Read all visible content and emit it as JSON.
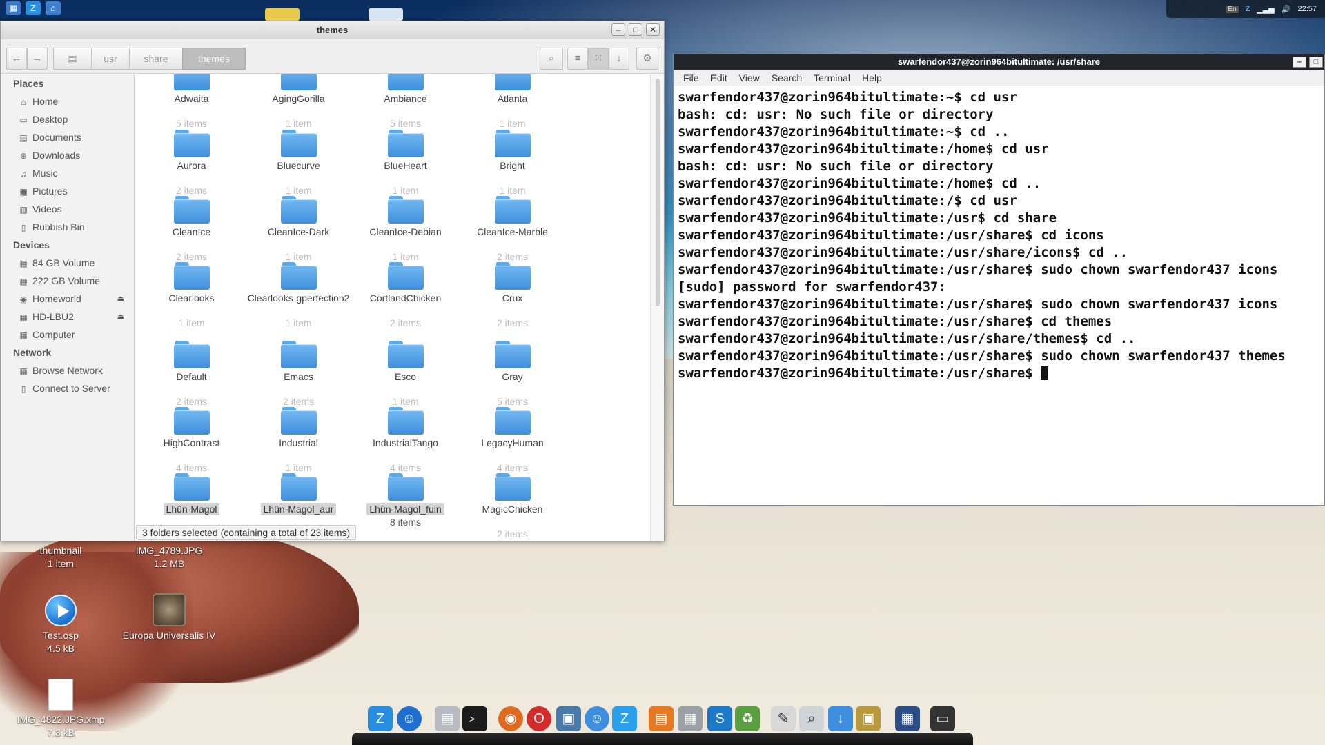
{
  "top_panel": {
    "tray": {
      "lang": "En",
      "clock": "22:57",
      "volume_icon": "speaker-icon"
    }
  },
  "file_manager": {
    "title": "themes",
    "breadcrumbs": [
      "usr",
      "share",
      "themes"
    ],
    "sidebar": {
      "sections": [
        {
          "heading": "Places",
          "items": [
            "Home",
            "Desktop",
            "Documents",
            "Downloads",
            "Music",
            "Pictures",
            "Videos",
            "Rubbish Bin"
          ]
        },
        {
          "heading": "Devices",
          "items": [
            "84 GB Volume",
            "222 GB Volume",
            "Homeworld",
            "HD-LBU2",
            "Computer"
          ]
        },
        {
          "heading": "Network",
          "items": [
            "Browse Network",
            "Connect to Server"
          ]
        }
      ]
    },
    "folders": [
      {
        "name": "Adwaita",
        "count": "5 items"
      },
      {
        "name": "AgingGorilla",
        "count": "1 item"
      },
      {
        "name": "Ambiance",
        "count": "5 items"
      },
      {
        "name": "Atlanta",
        "count": "1 item"
      },
      {
        "name": "Aurora",
        "count": "2 items"
      },
      {
        "name": "Bluecurve",
        "count": "1 item"
      },
      {
        "name": "BlueHeart",
        "count": "1 item"
      },
      {
        "name": "Bright",
        "count": "1 item"
      },
      {
        "name": "CleanIce",
        "count": "2 items"
      },
      {
        "name": "CleanIce-Dark",
        "count": "1 item"
      },
      {
        "name": "CleanIce-Debian",
        "count": "1 item"
      },
      {
        "name": "CleanIce-Marble",
        "count": "2 items"
      },
      {
        "name": "Clearlooks",
        "count": "1 item"
      },
      {
        "name": "Clearlooks-gperfection2",
        "count": "1 item"
      },
      {
        "name": "CortlandChicken",
        "count": "2 items"
      },
      {
        "name": "Crux",
        "count": "2 items"
      },
      {
        "name": "Default",
        "count": "2 items"
      },
      {
        "name": "Emacs",
        "count": "2 items"
      },
      {
        "name": "Esco",
        "count": "1 item"
      },
      {
        "name": "Gray",
        "count": "5 items"
      },
      {
        "name": "HighContrast",
        "count": "4 items"
      },
      {
        "name": "Industrial",
        "count": "1 item"
      },
      {
        "name": "IndustrialTango",
        "count": "4 items"
      },
      {
        "name": "LegacyHuman",
        "count": "4 items"
      },
      {
        "name": "Lhûn-Magol",
        "count": ""
      },
      {
        "name": "Lhûn-Magol_aur",
        "count": ""
      },
      {
        "name": "Lhûn-Magol_fuin",
        "count": "8 items"
      },
      {
        "name": "MagicChicken",
        "count": "2 items"
      }
    ],
    "status": "3 folders selected (containing a total of 23 items)"
  },
  "terminal": {
    "title": "swarfendor437@zorin964bitultimate: /usr/share",
    "menu": [
      "File",
      "Edit",
      "View",
      "Search",
      "Terminal",
      "Help"
    ],
    "lines": [
      "swarfendor437@zorin964bitultimate:~$ cd usr",
      "bash: cd: usr: No such file or directory",
      "swarfendor437@zorin964bitultimate:~$ cd ..",
      "swarfendor437@zorin964bitultimate:/home$ cd usr",
      "bash: cd: usr: No such file or directory",
      "swarfendor437@zorin964bitultimate:/home$ cd ..",
      "swarfendor437@zorin964bitultimate:/$ cd usr",
      "swarfendor437@zorin964bitultimate:/usr$ cd share",
      "swarfendor437@zorin964bitultimate:/usr/share$ cd icons",
      "swarfendor437@zorin964bitultimate:/usr/share/icons$ cd ..",
      "swarfendor437@zorin964bitultimate:/usr/share$ sudo chown swarfendor437 icons",
      "[sudo] password for swarfendor437:",
      "swarfendor437@zorin964bitultimate:/usr/share$ sudo chown swarfendor437 icons",
      "swarfendor437@zorin964bitultimate:/usr/share$ cd themes",
      "swarfendor437@zorin964bitultimate:/usr/share/themes$ cd ..",
      "swarfendor437@zorin964bitultimate:/usr/share$ sudo chown swarfendor437 themes",
      "swarfendor437@zorin964bitultimate:/usr/share$ "
    ]
  },
  "desktop_icons": [
    {
      "name": "thumbnail",
      "sub": "1 item"
    },
    {
      "name": "IMG_4789.JPG",
      "sub": "1.2 MB"
    },
    {
      "name": "Test.osp",
      "sub": "4.5 kB"
    },
    {
      "name": "Europa Universalis IV",
      "sub": ""
    },
    {
      "name": "IMG_4822.JPG.xmp",
      "sub": "7.3 kB"
    }
  ]
}
